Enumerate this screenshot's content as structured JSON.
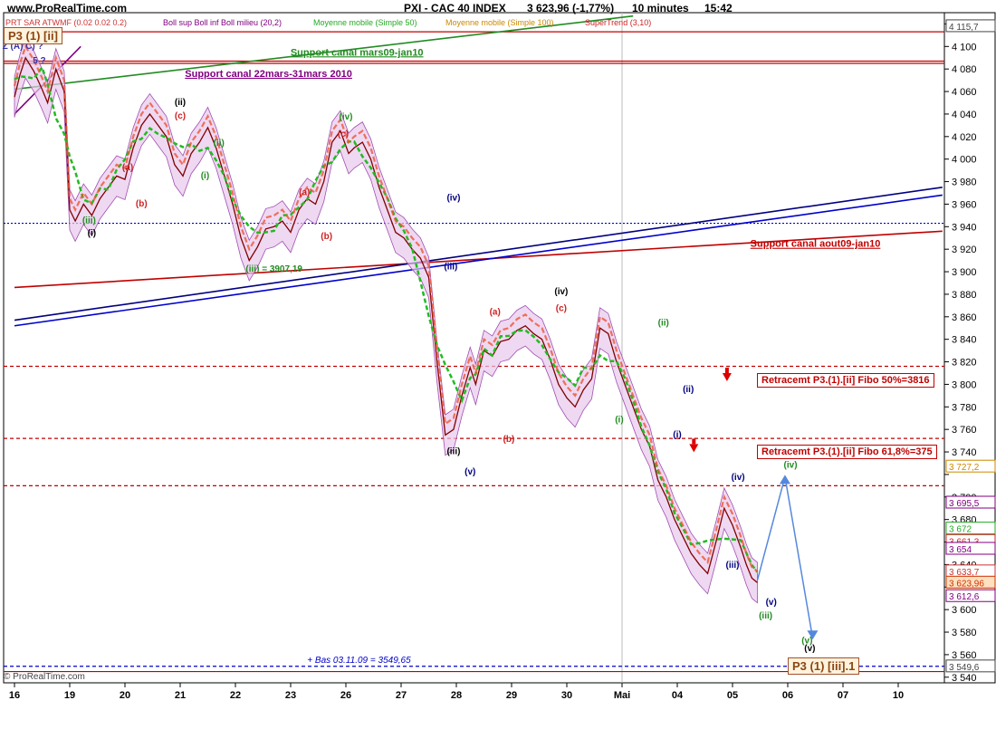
{
  "header": {
    "site": "www.ProRealTime.com",
    "title": "PXI - CAC 40 INDEX",
    "price": "3 623,96 (-1,77%)",
    "timeframe": "10 minutes",
    "time": "15:42"
  },
  "indicators": [
    {
      "text": "PRT SAR ATWMF (0.02 0.02 0.2)",
      "color": "#cc3333"
    },
    {
      "text": "Boll sup Boll inf Boll milieu (20,2)",
      "color": "#800080"
    },
    {
      "text": "Moyenne mobile (Simple 50)",
      "color": "#22aa22"
    },
    {
      "text": "Moyenne mobile (Simple 100)",
      "color": "#cc8800"
    },
    {
      "text": "SuperTrend (3,10)",
      "color": "#cc2222"
    }
  ],
  "footer": "© ProRealTime.com",
  "chart_data": {
    "type": "line",
    "title": "PXI - CAC 40 INDEX",
    "timeframe": "10 minutes",
    "ylim": [
      3535,
      4130
    ],
    "y_ticks": [
      3540,
      3560,
      3580,
      3600,
      3620,
      3640,
      3660,
      3680,
      3700,
      3720,
      3740,
      3760,
      3780,
      3800,
      3820,
      3840,
      3860,
      3880,
      3900,
      3920,
      3940,
      3960,
      3980,
      4000,
      4020,
      4040,
      4060,
      4080,
      4100,
      4120
    ],
    "y_tick_labels": [
      "3 540",
      "3 560",
      "3 580",
      "3 600",
      "",
      "3 640",
      "3 660",
      "3 680",
      "3 700",
      "",
      "3 740",
      "3 760",
      "3 780",
      "3 800",
      "3 820",
      "3 840",
      "3 860",
      "3 880",
      "3 900",
      "3 920",
      "3 940",
      "3 960",
      "3 980",
      "4 000",
      "4 020",
      "4 040",
      "4 060",
      "4 080",
      "4 100",
      "4 120"
    ],
    "x_labels": [
      "16",
      "19",
      "20",
      "21",
      "22",
      "23",
      "26",
      "27",
      "28",
      "29",
      "30",
      "Mai",
      "04",
      "05",
      "06",
      "07",
      "10"
    ],
    "x_positions": [
      0,
      1,
      2,
      3,
      4,
      5,
      6,
      7,
      8,
      9,
      10,
      11,
      12,
      13,
      14,
      15,
      16
    ],
    "price_path": {
      "x": [
        0.0,
        0.1,
        0.2,
        0.35,
        0.5,
        0.6,
        0.75,
        0.9,
        1.0,
        1.1,
        1.25,
        1.4,
        1.55,
        1.7,
        1.85,
        2.0,
        2.15,
        2.3,
        2.45,
        2.6,
        2.75,
        2.9,
        3.05,
        3.2,
        3.35,
        3.5,
        3.65,
        3.8,
        3.95,
        4.1,
        4.25,
        4.4,
        4.55,
        4.7,
        4.85,
        5.0,
        5.15,
        5.3,
        5.45,
        5.6,
        5.75,
        5.9,
        6.05,
        6.15,
        6.3,
        6.45,
        6.6,
        6.75,
        6.9,
        7.05,
        7.2,
        7.35,
        7.5,
        7.65,
        7.8,
        7.95,
        8.1,
        8.25,
        8.35,
        8.5,
        8.65,
        8.8,
        8.95,
        9.1,
        9.25,
        9.4,
        9.55,
        9.7,
        9.85,
        10.0,
        10.15,
        10.3,
        10.45,
        10.6,
        10.75,
        10.9,
        11.05,
        11.2,
        11.35,
        11.5,
        11.65,
        11.8,
        11.95,
        12.1,
        12.25,
        12.4,
        12.55,
        12.7,
        12.85,
        13.0,
        13.15,
        13.25,
        13.35,
        13.45
      ],
      "y": [
        4055,
        4075,
        4090,
        4078,
        4062,
        4050,
        4080,
        4060,
        3955,
        3945,
        3960,
        3950,
        3965,
        3975,
        3985,
        3982,
        4010,
        4030,
        4040,
        4030,
        4020,
        3995,
        3985,
        4005,
        4015,
        4028,
        4010,
        3985,
        3960,
        3930,
        3910,
        3922,
        3938,
        3940,
        3945,
        3935,
        3955,
        3965,
        3960,
        3980,
        4015,
        4025,
        4005,
        4010,
        4015,
        4000,
        3975,
        3955,
        3935,
        3930,
        3920,
        3912,
        3895,
        3820,
        3755,
        3760,
        3790,
        3815,
        3800,
        3830,
        3825,
        3838,
        3840,
        3848,
        3852,
        3845,
        3840,
        3822,
        3800,
        3788,
        3780,
        3795,
        3805,
        3850,
        3845,
        3820,
        3800,
        3780,
        3760,
        3745,
        3715,
        3700,
        3680,
        3665,
        3650,
        3640,
        3632,
        3660,
        3690,
        3675,
        3655,
        3640,
        3628,
        3624
      ],
      "color": "#800000"
    },
    "projection": {
      "x": [
        13.45,
        13.95,
        14.45
      ],
      "y": [
        3626,
        3718,
        3575
      ],
      "color": "#5588dd"
    },
    "horizontal_levels": [
      {
        "value": 4113,
        "color": "#c00000",
        "style": "solid"
      },
      {
        "value": 4087,
        "color": "#c00000",
        "style": "solid"
      },
      {
        "value": 4085,
        "color": "#c00000",
        "style": "solid"
      },
      {
        "value": 3816,
        "color": "#c00000",
        "style": "dashed",
        "label": "Retracemt P3.(1).[ii] Fibo 50%=3816"
      },
      {
        "value": 3752,
        "color": "#c00000",
        "style": "dashed",
        "label": "Retracemt P3.(1).[ii] Fibo 61,8%=375"
      },
      {
        "value": 3710,
        "color": "#c00000",
        "style": "dashed"
      },
      {
        "value": 3943,
        "color": "#0000cc",
        "style": "dotted"
      },
      {
        "value": 3549.65,
        "color": "#0000cc",
        "style": "dashed",
        "label": "Bas 03.11.09 = 3549,65"
      },
      {
        "value": 3545,
        "color": "#c00000",
        "style": "solid"
      }
    ],
    "trendlines": [
      {
        "name": "Support canal mars09-jan10",
        "color": "#228b22",
        "from": [
          0.0,
          4062
        ],
        "to": [
          11.2,
          4127
        ]
      },
      {
        "name": "Support canal 22mars-31mars 2010",
        "color": "#800080",
        "from": [
          0.0,
          4040
        ],
        "to": [
          1.2,
          4100
        ]
      },
      {
        "name": "Support canal aout09-jan10",
        "color": "#c00000",
        "from": [
          0.0,
          3886
        ],
        "to": [
          16.8,
          3936
        ]
      },
      {
        "name": "",
        "color": "#000080",
        "from": [
          0.0,
          3857
        ],
        "to": [
          16.8,
          3975
        ]
      },
      {
        "name": "",
        "color": "#0000cc",
        "from": [
          0.0,
          3852
        ],
        "to": [
          16.8,
          3968
        ]
      }
    ],
    "wave_labels": [
      {
        "text": "Z (A) C) ?",
        "x": 0.15,
        "y": 4098,
        "color": "#3333aa"
      },
      {
        "text": "5 ?",
        "x": 0.45,
        "y": 4085,
        "color": "#3333aa"
      },
      {
        "text": "(i)",
        "x": 1.4,
        "y": 3932,
        "color": "#000000"
      },
      {
        "text": "(ii)",
        "x": 3.0,
        "y": 4048,
        "color": "#000000"
      },
      {
        "text": "(iii)",
        "x": 7.95,
        "y": 3738,
        "color": "#000000"
      },
      {
        "text": "(iv)",
        "x": 9.9,
        "y": 3880,
        "color": "#000000"
      },
      {
        "text": "(v)",
        "x": 14.4,
        "y": 3563,
        "color": "#000000"
      },
      {
        "text": "(iii) = 3907,19",
        "x": 4.7,
        "y": 3900,
        "color": "#228b22"
      },
      {
        "text": "(a)",
        "x": 2.05,
        "y": 3990,
        "color": "#cc2222"
      },
      {
        "text": "(b)",
        "x": 2.3,
        "y": 3958,
        "color": "#cc2222"
      },
      {
        "text": "(c)",
        "x": 3.0,
        "y": 4036,
        "color": "#cc2222"
      },
      {
        "text": "(a)",
        "x": 5.25,
        "y": 3968,
        "color": "#cc2222"
      },
      {
        "text": "(b)",
        "x": 5.65,
        "y": 3929,
        "color": "#cc2222"
      },
      {
        "text": "(c)",
        "x": 5.95,
        "y": 4020,
        "color": "#cc2222"
      },
      {
        "text": "(a)",
        "x": 8.7,
        "y": 3862,
        "color": "#cc2222"
      },
      {
        "text": "(b)",
        "x": 8.95,
        "y": 3749,
        "color": "#cc2222"
      },
      {
        "text": "(c)",
        "x": 9.9,
        "y": 3865,
        "color": "#cc2222"
      },
      {
        "text": "(iv)",
        "x": 14.05,
        "y": 3726,
        "color": "#228b22"
      },
      {
        "text": "(iii)",
        "x": 13.6,
        "y": 3592,
        "color": "#228b22"
      },
      {
        "text": "(v)",
        "x": 14.35,
        "y": 3570,
        "color": "#228b22"
      },
      {
        "text": "(i)",
        "x": 10.95,
        "y": 3766,
        "color": "#228b22"
      },
      {
        "text": "(ii)",
        "x": 11.75,
        "y": 3852,
        "color": "#228b22"
      },
      {
        "text": "(iv)",
        "x": 6.0,
        "y": 4035,
        "color": "#228b22"
      },
      {
        "text": "(ii)",
        "x": 3.7,
        "y": 4012,
        "color": "#228b22"
      },
      {
        "text": "(i)",
        "x": 3.45,
        "y": 3983,
        "color": "#228b22"
      },
      {
        "text": "(iii)",
        "x": 1.35,
        "y": 3943,
        "color": "#228b22"
      },
      {
        "text": "(iv)",
        "x": 7.95,
        "y": 3963,
        "color": "#000080"
      },
      {
        "text": "(iii)",
        "x": 7.9,
        "y": 3902,
        "color": "#000080"
      },
      {
        "text": "(ii)",
        "x": 12.2,
        "y": 3793,
        "color": "#000080"
      },
      {
        "text": "(i)",
        "x": 12.0,
        "y": 3753,
        "color": "#000080"
      },
      {
        "text": "(iv)",
        "x": 13.1,
        "y": 3715,
        "color": "#000080"
      },
      {
        "text": "(iii)",
        "x": 13.0,
        "y": 3637,
        "color": "#000080"
      },
      {
        "text": "(v)",
        "x": 13.7,
        "y": 3604,
        "color": "#000080"
      },
      {
        "text": "(v)",
        "x": 8.25,
        "y": 3720,
        "color": "#000080"
      }
    ],
    "annotations": [
      {
        "text": "Support canal mars09-jan10",
        "x": 6.2,
        "y": 4092,
        "color": "#228b22"
      },
      {
        "text": "Support canal 22mars-31mars 2010",
        "x": 4.6,
        "y": 4073,
        "color": "#800080"
      },
      {
        "text": "Support canal aout09-jan10",
        "x": 14.5,
        "y": 3922,
        "color": "#c00000"
      }
    ],
    "price_tags": [
      {
        "value": "4 115,7",
        "y": 4118,
        "color": "#444444"
      },
      {
        "value": "3 727,2",
        "y": 3727,
        "color": "#cc8800"
      },
      {
        "value": "3 695,5",
        "y": 3695,
        "color": "#800080"
      },
      {
        "value": "3 672",
        "y": 3672,
        "color": "#22aa22"
      },
      {
        "value": "3 661,3",
        "y": 3661,
        "color": "#cc2222"
      },
      {
        "value": "3 654",
        "y": 3654,
        "color": "#800080"
      },
      {
        "value": "3 633,7",
        "y": 3634,
        "color": "#cc3333"
      },
      {
        "value": "3 623,96",
        "y": 3624,
        "color": "#cc3300"
      },
      {
        "value": "3 612,6",
        "y": 3612,
        "color": "#800080"
      },
      {
        "value": "3 549,6",
        "y": 3549.6,
        "color": "#444444"
      }
    ],
    "pboxes": [
      {
        "text": "P3 (1) [ii]"
      },
      {
        "text": "P3 (1) [iii].1"
      }
    ]
  }
}
